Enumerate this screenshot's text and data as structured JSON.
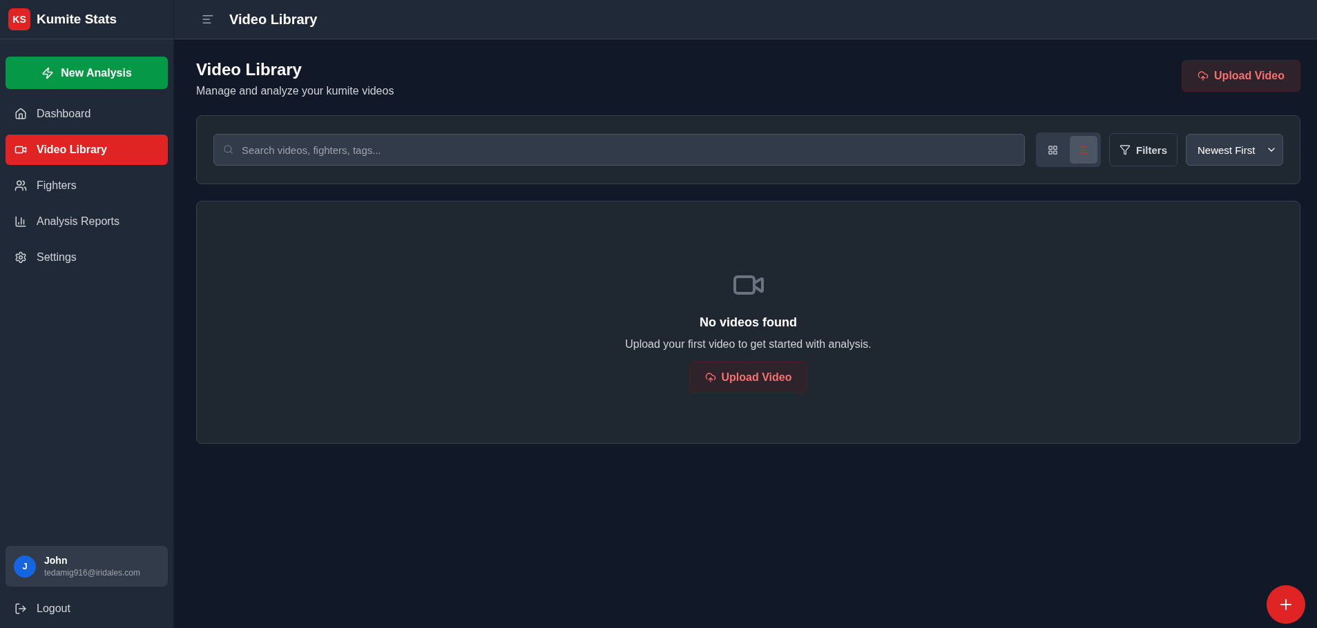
{
  "app": {
    "logo": "KS",
    "name": "Kumite Stats"
  },
  "header": {
    "title": "Video Library"
  },
  "sidebar": {
    "primary_action": "New Analysis",
    "items": [
      {
        "label": "Dashboard",
        "kind": "home",
        "selected": false
      },
      {
        "label": "Video Library",
        "kind": "video",
        "selected": true
      },
      {
        "label": "Fighters",
        "kind": "users",
        "selected": false
      },
      {
        "label": "Analysis Reports",
        "kind": "chart",
        "selected": false
      },
      {
        "label": "Settings",
        "kind": "settings",
        "selected": false
      }
    ],
    "user": {
      "initial": "J",
      "name": "John",
      "email": "tedamig916@iridales.com"
    },
    "logout": "Logout"
  },
  "page": {
    "title": "Video Library",
    "subtitle": "Manage and analyze your kumite videos",
    "upload_button": "Upload Video"
  },
  "toolbar": {
    "search": {
      "placeholder": "Search videos, fighters, tags..."
    },
    "view_modes": [
      {
        "kind": "grid",
        "selected": false
      },
      {
        "kind": "list",
        "selected": true
      }
    ],
    "filters": "Filters",
    "sort": "Newest First"
  },
  "empty_state": {
    "title": "No videos found",
    "message": "Upload your first video to get started with analysis.",
    "button": "Upload Video"
  }
}
